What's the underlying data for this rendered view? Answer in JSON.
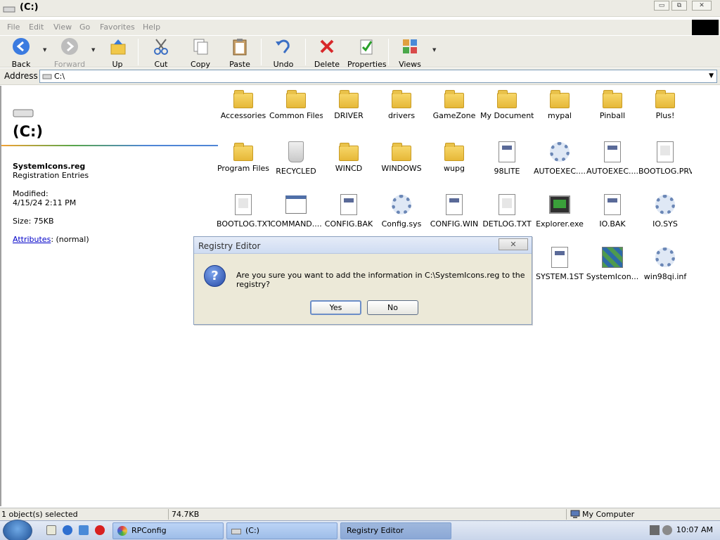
{
  "window": {
    "title": "(C:)",
    "minimize": "▭",
    "maximize": "⧉",
    "close": "✕"
  },
  "menu": [
    "File",
    "Edit",
    "View",
    "Go",
    "Favorites",
    "Help"
  ],
  "toolbar": {
    "back": "Back",
    "forward": "Forward",
    "up": "Up",
    "cut": "Cut",
    "copy": "Copy",
    "paste": "Paste",
    "undo": "Undo",
    "delete": "Delete",
    "properties": "Properties",
    "views": "Views"
  },
  "address": {
    "label": "Address",
    "value": "C:\\"
  },
  "left_panel": {
    "title": "(C:)",
    "file_name": "SystemIcons.reg",
    "file_type": "Registration Entries",
    "modified_label": "Modified:",
    "modified_value": "4/15/24 2:11 PM",
    "size": "Size: 75KB",
    "attributes_link": "Attributes",
    "attributes_value": ": (normal)"
  },
  "files": [
    {
      "name": "Accessories",
      "icon": "folder"
    },
    {
      "name": "Common Files",
      "icon": "folder"
    },
    {
      "name": "DRIVER",
      "icon": "folder"
    },
    {
      "name": "drivers",
      "icon": "folder"
    },
    {
      "name": "GameZone",
      "icon": "folder"
    },
    {
      "name": "My Documents",
      "icon": "folder"
    },
    {
      "name": "mypal",
      "icon": "folder"
    },
    {
      "name": "Pinball",
      "icon": "folder"
    },
    {
      "name": "Plus!",
      "icon": "folder"
    },
    {
      "name": "Program Files",
      "icon": "folder"
    },
    {
      "name": "RECYCLED",
      "icon": "recycle"
    },
    {
      "name": "WINCD",
      "icon": "folder"
    },
    {
      "name": "WINDOWS",
      "icon": "folder"
    },
    {
      "name": "wupg",
      "icon": "folder"
    },
    {
      "name": "98LITE",
      "icon": "doc"
    },
    {
      "name": "AUTOEXEC....",
      "icon": "gear"
    },
    {
      "name": "AUTOEXEC....",
      "icon": "doc"
    },
    {
      "name": "BOOTLOG.PRV",
      "icon": "doc-plain"
    },
    {
      "name": "BOOTLOG.TXT",
      "icon": "doc-plain"
    },
    {
      "name": "COMMAND....",
      "icon": "cmd"
    },
    {
      "name": "CONFIG.BAK",
      "icon": "doc"
    },
    {
      "name": "Config.sys",
      "icon": "gear"
    },
    {
      "name": "CONFIG.WIN",
      "icon": "doc"
    },
    {
      "name": "DETLOG.TXT",
      "icon": "doc-plain"
    },
    {
      "name": "Explorer.exe",
      "icon": "exe"
    },
    {
      "name": "IO.BAK",
      "icon": "doc"
    },
    {
      "name": "IO.SYS",
      "icon": "gear"
    },
    {
      "name": "SYSTEM.1ST",
      "icon": "doc"
    },
    {
      "name": "SystemIcon...",
      "icon": "reg"
    },
    {
      "name": "win98qi.inf",
      "icon": "gear"
    }
  ],
  "dialog": {
    "title": "Registry Editor",
    "close": "✕",
    "icon": "?",
    "message": "Are you sure you want to add the information in C:\\SystemIcons.reg to the registry?",
    "yes": "Yes",
    "no": "No"
  },
  "status": {
    "selected": "1 object(s) selected",
    "size": "74.7KB",
    "location": "My Computer"
  },
  "taskbar": {
    "tasks": [
      "RPConfig",
      "(C:)",
      "Registry Editor"
    ],
    "clock": "10:07 AM"
  }
}
